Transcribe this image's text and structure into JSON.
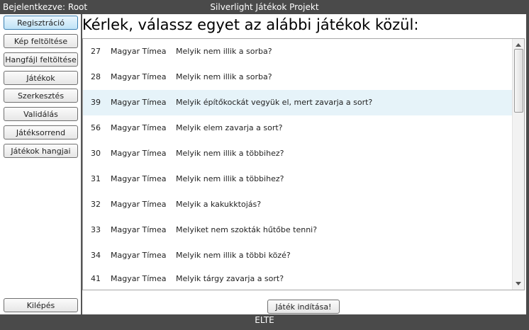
{
  "header": {
    "login_status": "Bejelentkezve: Root",
    "app_title": "Silverlight Játékok Projekt"
  },
  "sidebar": {
    "items": [
      {
        "label": "Regisztráció",
        "active": true
      },
      {
        "label": "Kép feltöltése"
      },
      {
        "label": "Hangfájl feltöltése"
      },
      {
        "label": "Játékok"
      },
      {
        "label": "Szerkesztés"
      },
      {
        "label": "Validálás"
      },
      {
        "label": "Játéksorrend"
      },
      {
        "label": "Játékok hangjai"
      }
    ],
    "logout_label": "Kilépés"
  },
  "main": {
    "heading": "Kérlek, válassz egyet az alábbi játékok közül:",
    "games": [
      {
        "id": "27",
        "author": "Magyar Tímea",
        "question": "Melyik nem illik a sorba?"
      },
      {
        "id": "28",
        "author": "Magyar Tímea",
        "question": "Melyik nem illik a sorba?"
      },
      {
        "id": "39",
        "author": "Magyar Tímea",
        "question": "Melyik építőkockát vegyük el, mert zavarja a sort?",
        "selected": true
      },
      {
        "id": "56",
        "author": "Magyar Tímea",
        "question": "Melyik elem zavarja a sort?"
      },
      {
        "id": "30",
        "author": "Magyar Tímea",
        "question": "Melyik nem illik a többihez?"
      },
      {
        "id": "31",
        "author": "Magyar Tímea",
        "question": "Melyik nem illik a többihez?"
      },
      {
        "id": "32",
        "author": "Magyar Tímea",
        "question": "Melyik a kakukktojás?"
      },
      {
        "id": "33",
        "author": "Magyar Tímea",
        "question": "Melyiket nem szokták hűtőbe tenni?"
      },
      {
        "id": "34",
        "author": "Magyar Tímea",
        "question": "Melyik nem illik a többi közé?"
      },
      {
        "id": "41",
        "author": "Magyar Tímea",
        "question": "Melyik tárgy zavarja a sort?"
      }
    ],
    "start_label": "Játék indítása!"
  },
  "footer": {
    "text": "ELTE"
  },
  "colors": {
    "frame": "#4a4a4a",
    "selected_row": "#e6f3f9",
    "active_button": "#bfe3f7"
  }
}
